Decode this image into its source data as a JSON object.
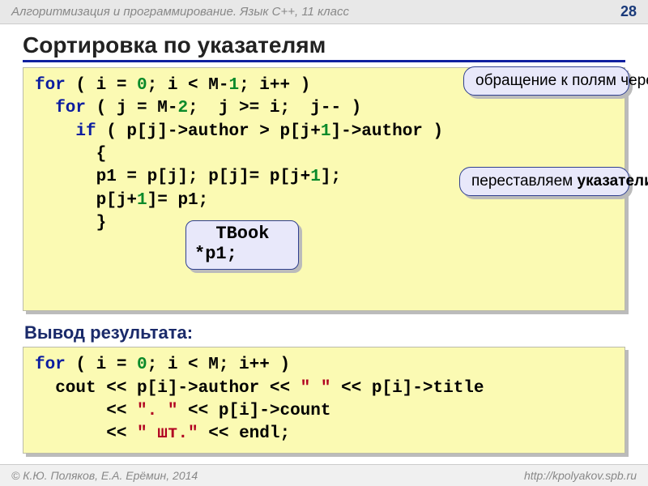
{
  "header": {
    "course": "Алгоритмизация и программирование. Язык С++, 11 класс",
    "page": "28"
  },
  "title": "Сортировка по указателям",
  "code1": {
    "l1": {
      "a": "for",
      "b": " ( i = ",
      "c": "0",
      "d": "; i < M-",
      "e": "1",
      "f": "; i++ )"
    },
    "l2": {
      "a": "  for",
      "b": " ( j = M-",
      "c": "2",
      "d": ";  j >= i;  j-- )"
    },
    "l3": {
      "a": "    if",
      "b": " ( p[j]->author > p[j+",
      "c": "1",
      "d": "]->author )"
    },
    "l4": "      {",
    "l5": {
      "a": "      p1 = p[j]; p[j]= p[j+",
      "b": "1",
      "c": "];"
    },
    "l6": {
      "a": "      p[j+",
      "b": "1",
      "c": "]= p1;"
    },
    "l7": "      }"
  },
  "callouts": {
    "fields": "обращение к полям через указатели",
    "swap_a": "переставляем ",
    "swap_b": "указатели",
    "swap_c": "!",
    "tbook": "  TBook\n*p1;"
  },
  "subhead": "Вывод результата:",
  "code2": {
    "l1": {
      "a": "for",
      "b": " ( i = ",
      "c": "0",
      "d": "; i < M; i++ )"
    },
    "l2": {
      "a": "  cout << p[i]->author << ",
      "b": "\" \"",
      "c": " << p[i]->title"
    },
    "l3": {
      "a": "       << ",
      "b": "\". \"",
      "c": " << p[i]->count"
    },
    "l4": {
      "a": "       << ",
      "b": "\" шт.\"",
      "c": " << endl;"
    }
  },
  "footer": {
    "left": "© К.Ю. Поляков, Е.А. Ерёмин, 2014",
    "right": "http://kpolyakov.spb.ru"
  }
}
